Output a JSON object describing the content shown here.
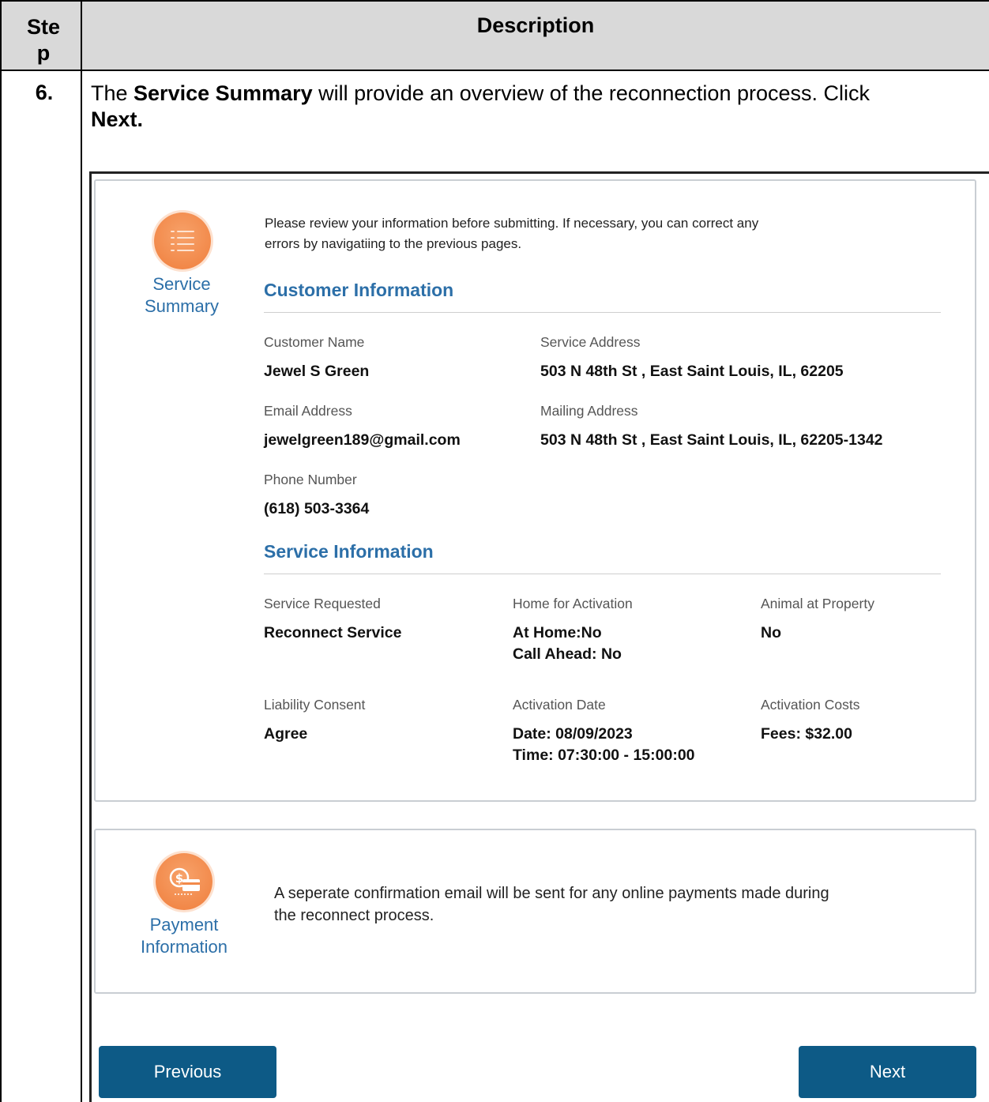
{
  "table": {
    "header_step": "Ste p",
    "header_description": "Description",
    "step_number": "6.",
    "step_text_1": "The ",
    "step_text_bold_1": "Service Summary",
    "step_text_2": " will provide an overview of the reconnection process.  Click ",
    "step_text_bold_2": "Next."
  },
  "summary": {
    "icon_label_1": "Service",
    "icon_label_2": "Summary",
    "intro_line_1": "Please review your information before submitting. If necessary, you can correct any",
    "intro_line_2": "errors by navigatiing to the previous pages.",
    "customer_section_title": "Customer Information",
    "customer_name_label": "Customer Name",
    "customer_name_value": "Jewel S Green",
    "service_address_label": "Service Address",
    "service_address_value": "503 N 48th St , East Saint Louis, IL, 62205",
    "email_label": "Email Address",
    "email_value": "jewelgreen189@gmail.com",
    "mailing_address_label": "Mailing Address",
    "mailing_address_value": "503 N 48th St , East Saint Louis, IL, 62205-1342",
    "phone_label": "Phone Number",
    "phone_value": "(618) 503-3364",
    "service_section_title": "Service Information",
    "service_requested_label": "Service Requested",
    "service_requested_value": "Reconnect Service",
    "home_activation_label": "Home for Activation",
    "home_activation_line_1": "At Home:No",
    "home_activation_line_2": "Call Ahead: No",
    "animal_label": "Animal at Property",
    "animal_value": "No",
    "liability_label": "Liability Consent",
    "liability_value": "Agree",
    "activation_date_label": "Activation Date",
    "activation_date_line_1": "Date: 08/09/2023",
    "activation_date_line_2": "Time: 07:30:00 - 15:00:00",
    "activation_costs_label": "Activation Costs",
    "activation_costs_value": "Fees: $32.00"
  },
  "payment": {
    "icon_label_1": "Payment",
    "icon_label_2": "Information",
    "text_line_1": "A seperate confirmation email will be sent for any online payments made during",
    "text_line_2": "the reconnect process."
  },
  "buttons": {
    "previous_label": "Previous",
    "next_label": "Next"
  },
  "colors": {
    "accent": "#2c6fa8",
    "button": "#0d5a86",
    "icon_orange": "#f2894a",
    "header_gray": "#d9d9d9"
  }
}
